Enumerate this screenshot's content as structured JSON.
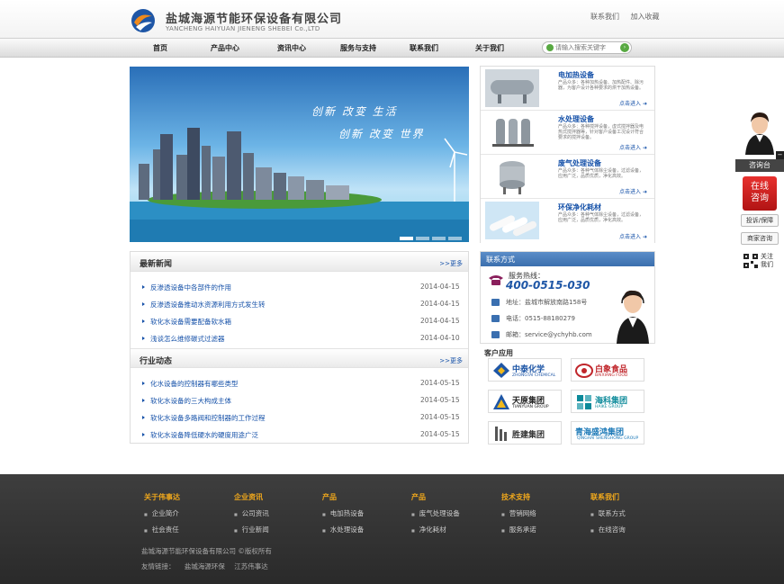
{
  "header": {
    "company_cn": "盐城海源节能环保设备有限公司",
    "company_en": "YANCHENG HAIYUAN JIENENG SHEBEI Co.,LTD",
    "links": [
      "联系我们",
      "加入收藏"
    ]
  },
  "nav": {
    "items": [
      "首页",
      "产品中心",
      "资讯中心",
      "服务与支持",
      "联系我们",
      "关于我们"
    ],
    "search_placeholder": "请输入搜索关键字"
  },
  "banner": {
    "slogan1": "创新 改变 生活",
    "slogan2": "创新 改变 世界",
    "slides": 4,
    "active_slide": 1
  },
  "products": [
    {
      "name": "电加热设备",
      "desc": "产品众多：各种加热设备、加热配件、除污器，为客户设计各种要求的烘干加热设备。",
      "more": "点击进入"
    },
    {
      "name": "水处理设备",
      "desc": "产品众多：各种搅拌设备，虚式搅拌器及电热式搅拌器等，针对客户设备工况设计符合要求的搅拌设备。",
      "more": "点击进入"
    },
    {
      "name": "废气处理设备",
      "desc": "产品众多：各种气体除尘设备，过滤设备，应用广泛，品质优质，净化高效。",
      "more": "点击进入"
    },
    {
      "name": "环保净化耗材",
      "desc": "产品众多：各种气体除尘设备，过滤设备，应用广泛，品质优质，净化高效。",
      "more": "点击进入"
    }
  ],
  "news": {
    "title": "最新新闻",
    "more": ">>更多",
    "items": [
      {
        "text": "反渗透设备中各部件的作用",
        "date": "2014-04-15"
      },
      {
        "text": "反渗透设备推动水资源利用方式发生转",
        "date": "2014-04-15"
      },
      {
        "text": "软化水设备需要配备软水箱",
        "date": "2014-04-15"
      },
      {
        "text": "浅谈怎么维修碳式过滤器",
        "date": "2014-04-10"
      }
    ]
  },
  "industry": {
    "title": "行业动态",
    "more": ">>更多",
    "items": [
      {
        "text": "化水设备的控制器有哪些类型",
        "date": "2014-05-15"
      },
      {
        "text": "软化水设备的三大构成主体",
        "date": "2014-05-15"
      },
      {
        "text": "软化水设备多路阀和控制器的工作过程",
        "date": "2014-05-15"
      },
      {
        "text": "软化水设备降低硬水的硬度用途广泛",
        "date": "2014-05-15"
      }
    ]
  },
  "contact": {
    "title": "联系方式",
    "hotline_label": "服务热线：",
    "hotline": "400-0515-030",
    "address": "地址：盐城市解放南路158号",
    "phone": "电话：0515-88180279",
    "email": "邮箱：service@ychyhb.com"
  },
  "clients": {
    "title": "客户应用",
    "items": [
      {
        "cn": "中泰化学",
        "en": "ZHONGTAI CHEMICAL",
        "color": "#1e56a6"
      },
      {
        "cn": "白象食品",
        "en": "BAIXIANG FOOD",
        "color": "#c0262b"
      },
      {
        "cn": "天原集团",
        "en": "TIANYUAN GROUP",
        "color": "#222222"
      },
      {
        "cn": "海科集团",
        "en": "HAIKE GROUP",
        "color": "#0c8a9a"
      },
      {
        "cn": "胜建集团",
        "en": "",
        "color": "#333333"
      },
      {
        "cn": "青海盛鸿集团",
        "en": "QINGHAI SHENGHONG GROUP",
        "color": "#1e7ab8"
      }
    ]
  },
  "float": {
    "bar": "咨询台",
    "online": [
      "在线",
      "咨询"
    ],
    "buttons": [
      "投诉/保障",
      "商家咨询"
    ],
    "qr_label": [
      "关注",
      "我们"
    ]
  },
  "footer": {
    "columns": [
      {
        "title": "关于伟事达",
        "items": [
          "企业简介",
          "社会责任"
        ]
      },
      {
        "title": "企业资讯",
        "items": [
          "公司资讯",
          "行业新闻"
        ]
      },
      {
        "title": "产品",
        "items": [
          "电加热设备",
          "水处理设备"
        ]
      },
      {
        "title": "产品",
        "items": [
          "废气处理设备",
          "净化耗材"
        ]
      },
      {
        "title": "技术支持",
        "items": [
          "营销网络",
          "服务承诺"
        ]
      },
      {
        "title": "联系我们",
        "items": [
          "联系方式",
          "在线咨询"
        ]
      }
    ],
    "copyright": "盐城海源节能环保设备有限公司 ©版权所有",
    "friends_label": "友情链接：",
    "friends": [
      "盐城海源环保",
      "江苏伟事达"
    ]
  }
}
